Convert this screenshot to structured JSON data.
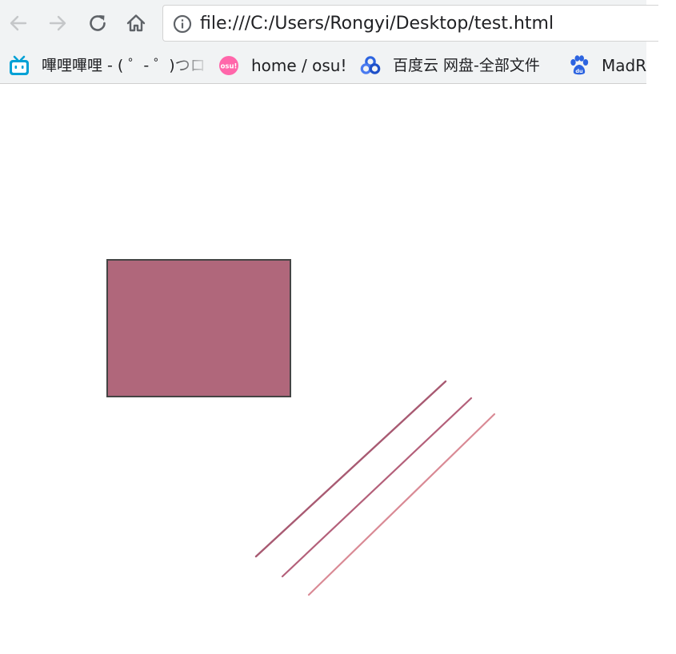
{
  "toolbar": {
    "back_icon": "back-arrow-icon",
    "forward_icon": "forward-arrow-icon",
    "reload_icon": "reload-icon",
    "home_icon": "home-icon",
    "info_icon": "info-icon",
    "url": "file:///C:/Users/Rongyi/Desktop/test.html"
  },
  "bookmarks": [
    {
      "label": "嗶哩嗶哩 - ( ゜- ゜)つロ",
      "icon": "bilibili-tv-icon"
    },
    {
      "label": "home / osu!",
      "icon": "osu-logo-icon",
      "icon_text": "osu!"
    },
    {
      "label": "百度云 网盘-全部文件",
      "icon": "baidu-cloud-icon"
    },
    {
      "label": "MadR",
      "icon": "baidu-paw-icon",
      "icon_text": "du"
    }
  ],
  "canvas": {
    "rect_fill": "#b0677b",
    "rect_stroke": "#444444",
    "line_colors": [
      "#a85a72",
      "#b4607a",
      "#d98a95"
    ]
  },
  "colors": {
    "toolbar_bg": "#f1f3f4",
    "bilibili_blue": "#00a1d6",
    "osu_pink": "#ff66aa",
    "baidu_blue": "#2d64e0"
  }
}
